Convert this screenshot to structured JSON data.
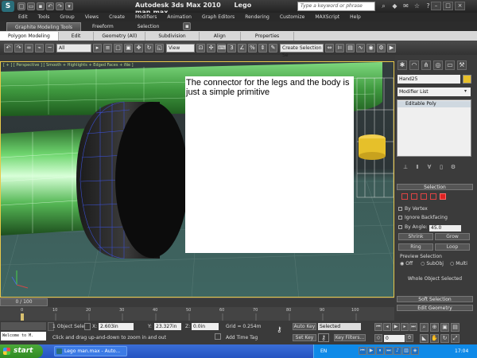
{
  "window": {
    "app_title": "Autodesk 3ds Max  2010",
    "file_title": "Lego man.max",
    "search_placeholder": "Type a keyword or phrase"
  },
  "quick_access": [
    "new",
    "open",
    "save",
    "undo",
    "redo",
    "dropdown"
  ],
  "menu": [
    "Edit",
    "Tools",
    "Group",
    "Views",
    "Create",
    "Modifiers",
    "Animation",
    "Graph Editors",
    "Rendering",
    "Customize",
    "MAXScript",
    "Help"
  ],
  "ribbon": {
    "tabs": [
      "Graphite Modeling Tools",
      "Freeform",
      "Selection"
    ],
    "panels": [
      "Polygon Modeling",
      "Edit",
      "Geometry (All)",
      "Subdivision",
      "Align",
      "Properties"
    ]
  },
  "toolbar": {
    "filter_value": "All",
    "view_value": "View",
    "named_selection_value": "Create Selection Se"
  },
  "viewport": {
    "label": "[ + ] [ Perspective ] [ Smooth + Highlights + Edged Faces + iNe ]",
    "caption": "The connector for the legs and the body is just a simple primitive"
  },
  "command_panel": {
    "object_name": "Hand25",
    "object_color": "#e8c02a",
    "modifier_list": "Modifier List",
    "stack_item": "Editable Poly",
    "selection": {
      "header": "Selection",
      "by_vertex": "By Vertex",
      "ignore_backfacing": "Ignore Backfacing",
      "by_angle": "By Angle:",
      "angle_value": "45.0",
      "shrink": "Shrink",
      "grow": "Grow",
      "ring": "Ring",
      "loop": "Loop",
      "preview_header": "Preview Selection",
      "preview_off": "Off",
      "preview_subobj": "SubObj",
      "preview_multi": "Multi",
      "whole_object": "Whole Object Selected"
    },
    "soft_selection": "Soft Selection",
    "edit_geometry": "Edit Geometry"
  },
  "timeline": {
    "slider": "0 / 100",
    "ticks": [
      "0",
      "10",
      "20",
      "30",
      "40",
      "50",
      "60",
      "70",
      "80",
      "90",
      "100"
    ]
  },
  "status": {
    "maxscript": "Welcome to M.",
    "selection_info": "1 Object Sele",
    "prompt": "Click and drag up-and-down to zoom in and out",
    "x_label": "X:",
    "x_value": "2.603in",
    "y_label": "Y:",
    "y_value": "23.327in",
    "z_label": "Z:",
    "z_value": "0.0in",
    "grid": "Grid = 0.254m",
    "add_time_tag": "Add Time Tag",
    "auto_key": "Auto Key",
    "auto_key_value": "Selected",
    "set_key": "Set Key",
    "key_filters": "Key Filters...",
    "frame_value": "0"
  },
  "taskbar": {
    "start": "start",
    "task": "Lego man.max - Auto...",
    "language": "EN",
    "clock": "17:04"
  }
}
